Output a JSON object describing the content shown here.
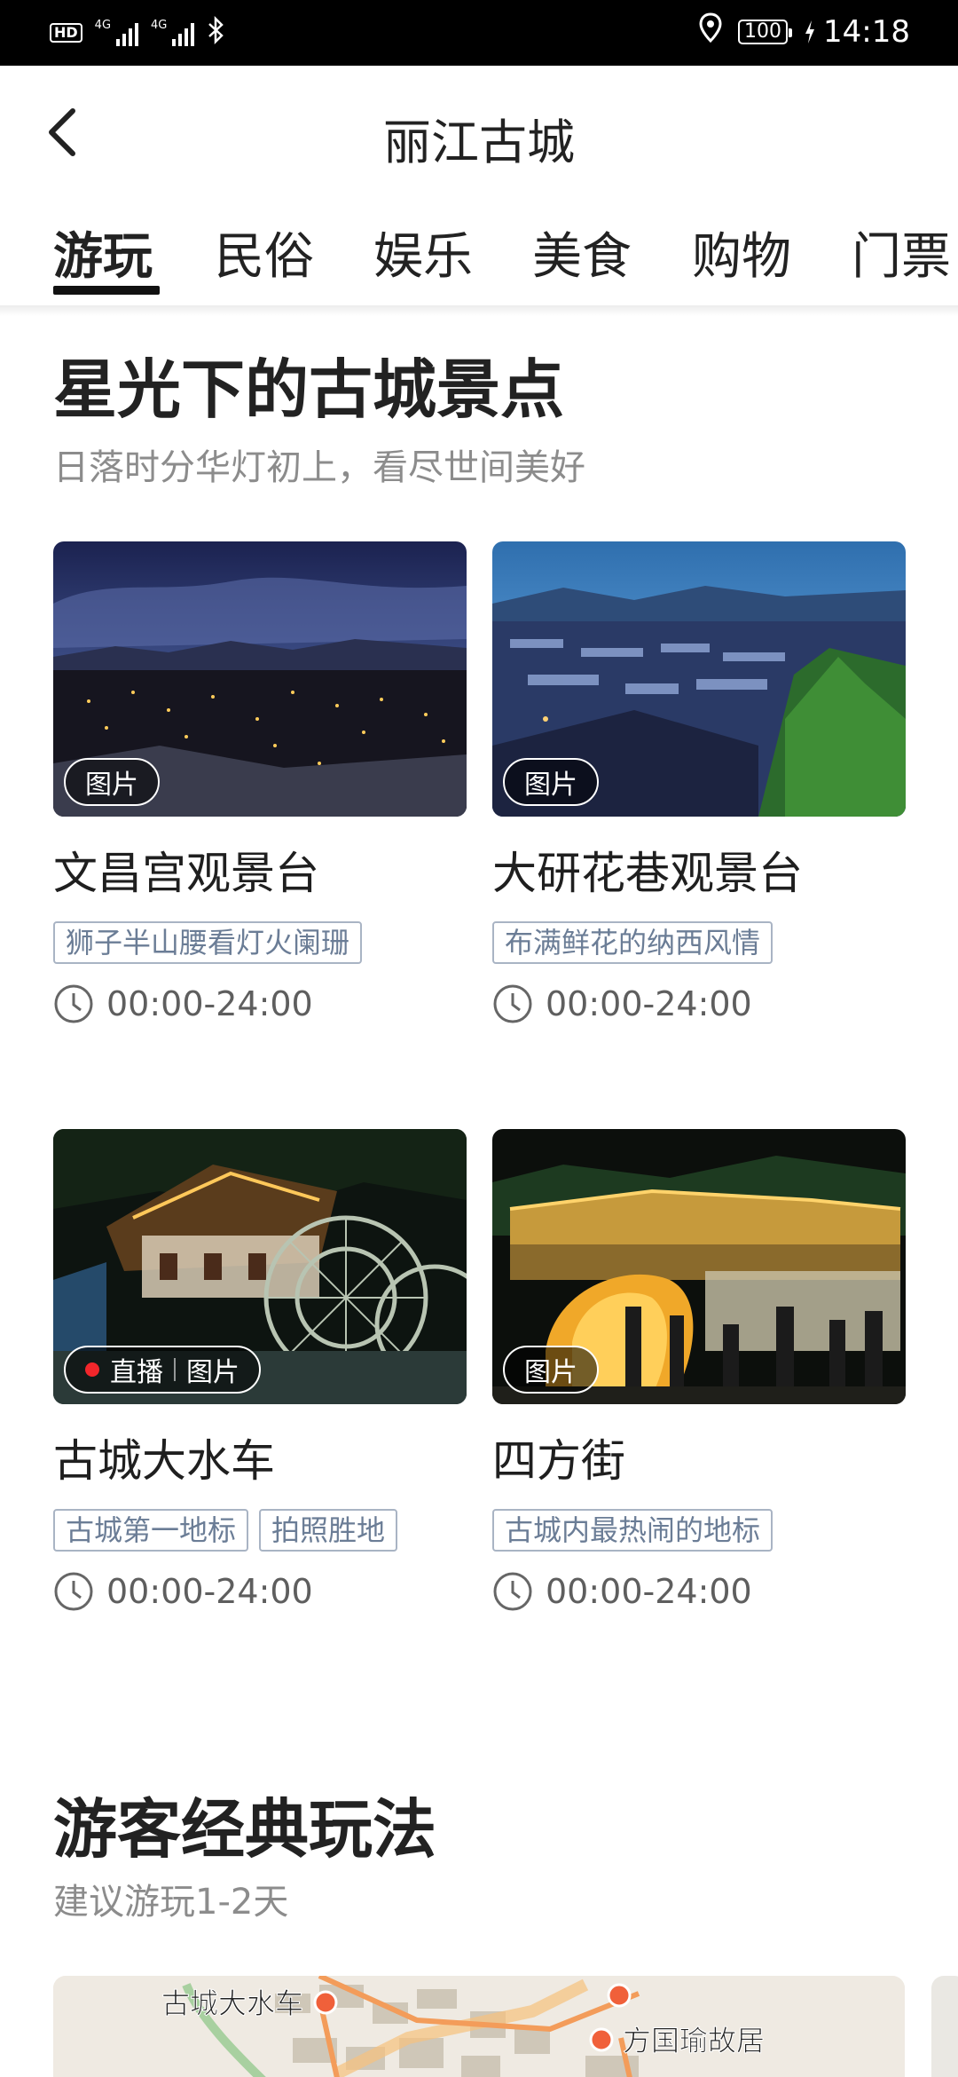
{
  "status_bar": {
    "hd": "HD",
    "net1": "4G",
    "net2": "4G",
    "battery": "100",
    "time": "14:18",
    "icons": [
      "hd-icon",
      "signal-icon",
      "signal-icon",
      "bluetooth-icon",
      "location-icon",
      "battery-icon",
      "charging-icon"
    ]
  },
  "header": {
    "title": "丽江古城",
    "back_icon": "chevron-left-icon"
  },
  "tabs": [
    {
      "label": "游玩",
      "active": true
    },
    {
      "label": "民俗"
    },
    {
      "label": "娱乐"
    },
    {
      "label": "美食"
    },
    {
      "label": "购物"
    },
    {
      "label": "门票"
    }
  ],
  "section1": {
    "title": "星光下的古城景点",
    "subtitle": "日落时分华灯初上，看尽世间美好"
  },
  "cards": [
    {
      "name": "文昌宫观景台",
      "badge": "图片",
      "tags": [
        "狮子半山腰看灯火阑珊"
      ],
      "hours": "00:00-24:00"
    },
    {
      "name": "大研花巷观景台",
      "badge": "图片",
      "tags": [
        "布满鲜花的纳西风情"
      ],
      "hours": "00:00-24:00"
    },
    {
      "name": "古城大水车",
      "live": "直播",
      "badge": "图片",
      "tags": [
        "古城第一地标",
        "拍照胜地"
      ],
      "hours": "00:00-24:00"
    },
    {
      "name": "四方街",
      "badge": "图片",
      "tags": [
        "古城内最热闹的地标"
      ],
      "hours": "00:00-24:00"
    }
  ],
  "section2": {
    "title": "游客经典玩法",
    "subtitle": "建议游玩1-2天"
  },
  "map": {
    "labels": [
      "古城大水车",
      "方国瑜故居"
    ],
    "route_color": "#f39c5a",
    "marker_color": "#f0603a"
  },
  "colors": {
    "accent": "#111111",
    "tag_border": "#a9b4c4",
    "live_dot": "#f2262b"
  }
}
